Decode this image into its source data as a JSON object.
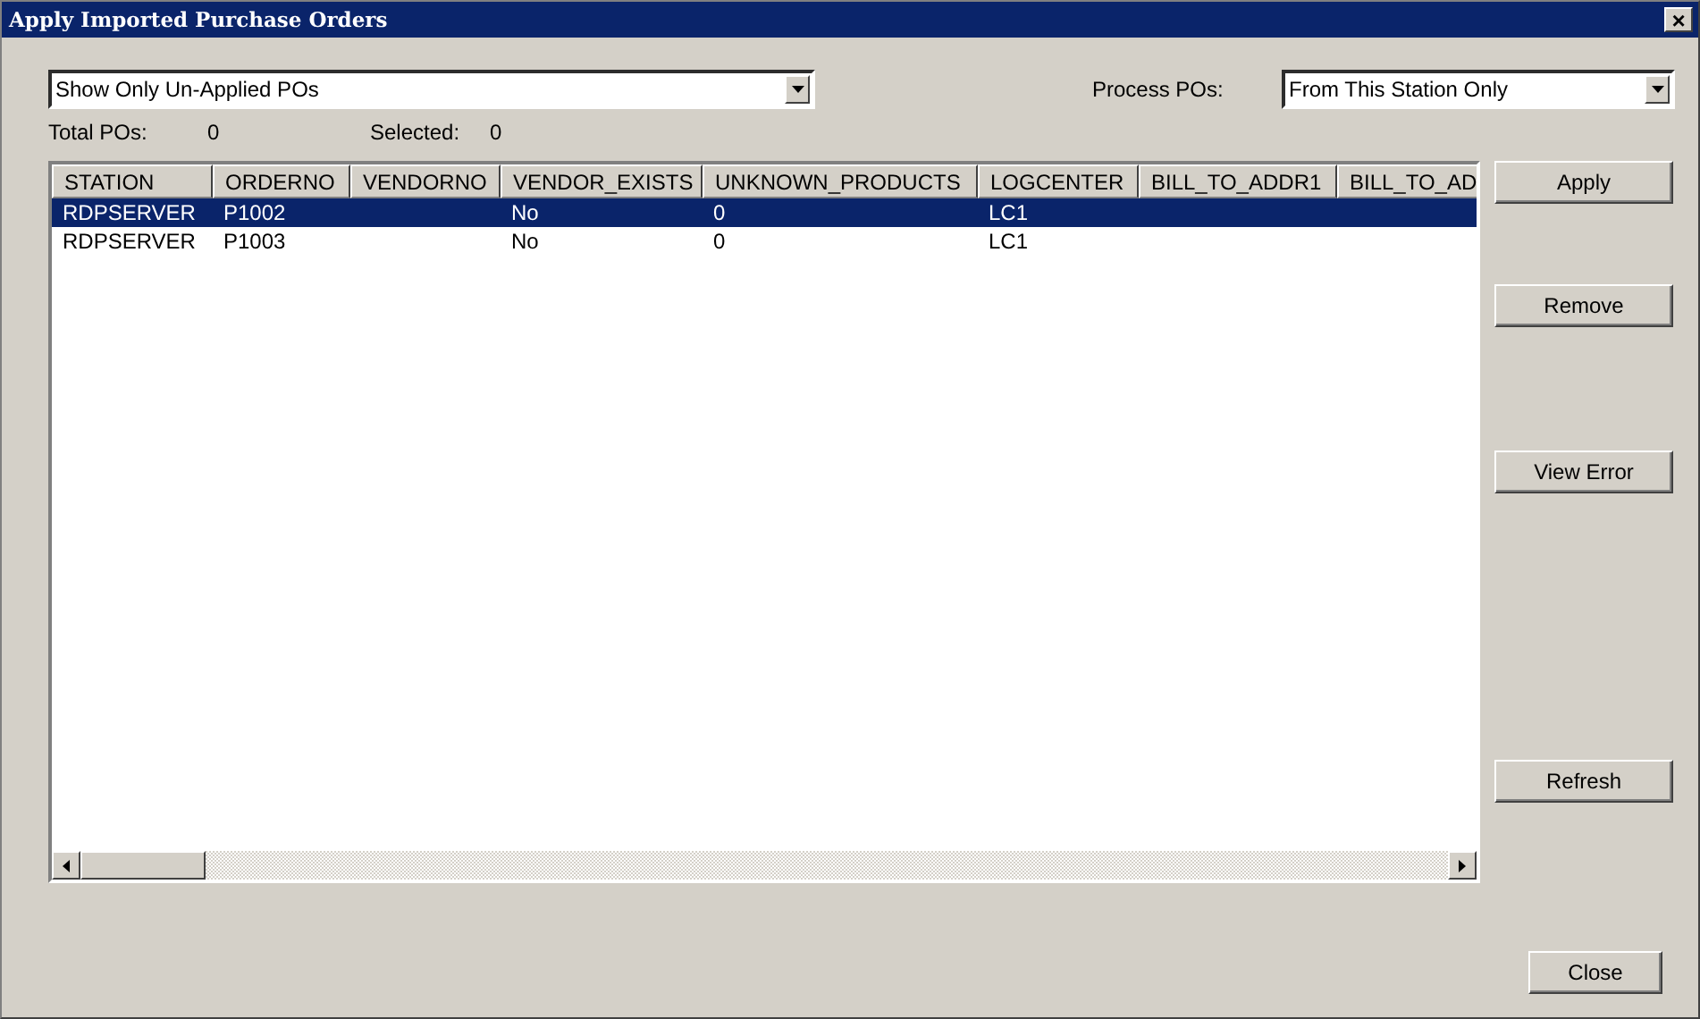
{
  "window": {
    "title": "Apply Imported Purchase Orders",
    "close_glyph": "×"
  },
  "filter": {
    "value": "Show Only Un-Applied POs"
  },
  "process": {
    "label": "Process POs:",
    "value": "From This Station Only"
  },
  "totals": {
    "total_label": "Total POs:",
    "total": "0",
    "selected_label": "Selected:",
    "selected": "0"
  },
  "table": {
    "columns": [
      "STATION",
      "ORDERNO",
      "VENDORNO",
      "VENDOR_EXISTS",
      "UNKNOWN_PRODUCTS",
      "LOGCENTER",
      "BILL_TO_ADDR1",
      "BILL_TO_AD"
    ],
    "rows": [
      {
        "selected": true,
        "station": "RDPSERVER",
        "orderno": "P1002",
        "vendor_exists": "No",
        "unknown_products": "0",
        "logcenter": "LC1"
      },
      {
        "selected": false,
        "station": "RDPSERVER",
        "orderno": "P1003",
        "vendor_exists": "No",
        "unknown_products": "0",
        "logcenter": "LC1"
      }
    ]
  },
  "side_buttons": [
    "Apply",
    "Remove",
    "View Error",
    "Refresh"
  ],
  "close_button": "Close"
}
